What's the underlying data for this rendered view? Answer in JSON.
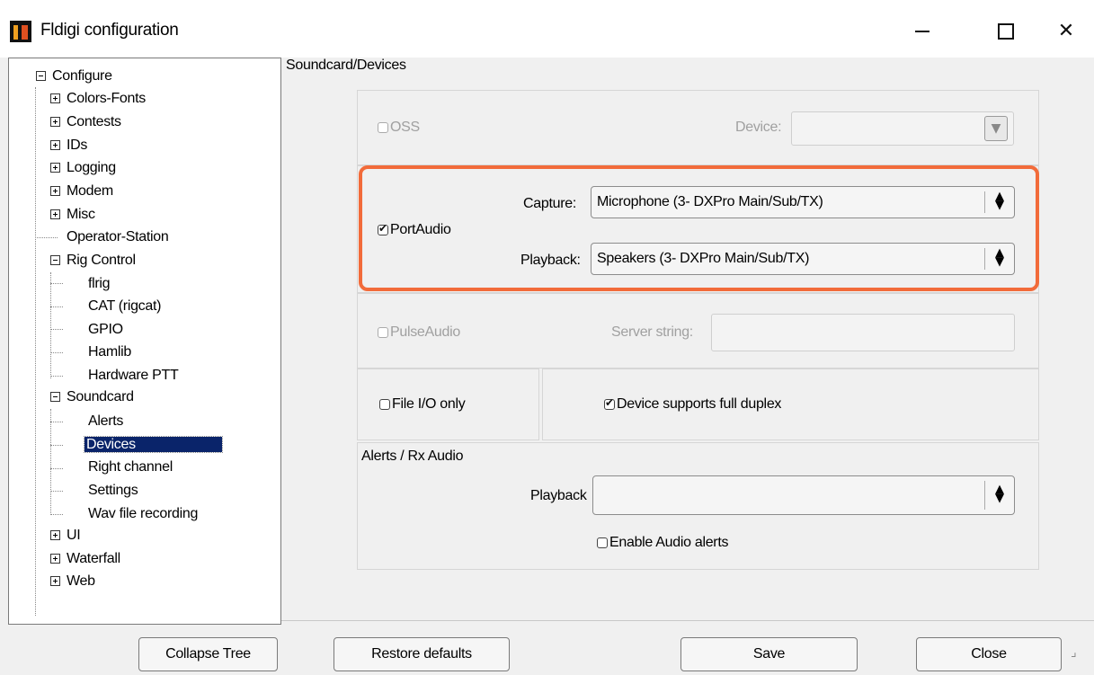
{
  "window": {
    "title": "Fldigi configuration"
  },
  "tree": {
    "items": [
      {
        "label": "Configure"
      },
      {
        "label": "Colors-Fonts"
      },
      {
        "label": "Contests"
      },
      {
        "label": "IDs"
      },
      {
        "label": "Logging"
      },
      {
        "label": "Modem"
      },
      {
        "label": "Misc"
      },
      {
        "label": "Operator-Station"
      },
      {
        "label": "Rig Control"
      },
      {
        "label": "flrig"
      },
      {
        "label": "CAT (rigcat)"
      },
      {
        "label": "GPIO"
      },
      {
        "label": "Hamlib"
      },
      {
        "label": "Hardware PTT"
      },
      {
        "label": "Soundcard"
      },
      {
        "label": "Alerts"
      },
      {
        "label": "Devices"
      },
      {
        "label": "Right channel"
      },
      {
        "label": "Settings"
      },
      {
        "label": "Wav file recording"
      },
      {
        "label": "UI"
      },
      {
        "label": "Waterfall"
      },
      {
        "label": "Web"
      }
    ],
    "selected": "Devices"
  },
  "section": {
    "title": "Soundcard/Devices"
  },
  "oss": {
    "label": "OSS",
    "device_label": "Device:",
    "device_value": ""
  },
  "portaudio": {
    "label": "PortAudio",
    "capture_label": "Capture:",
    "capture_value": "Microphone (3- DXPro Main/Sub/TX)",
    "playback_label": "Playback:",
    "playback_value": "Speakers (3- DXPro Main/Sub/TX)"
  },
  "pulseaudio": {
    "label": "PulseAudio",
    "server_label": "Server string:",
    "server_value": ""
  },
  "fileio": {
    "label": "File I/O only",
    "checked": false
  },
  "duplex": {
    "label": "Device supports full duplex",
    "checked": true
  },
  "alerts": {
    "title": "Alerts / Rx Audio",
    "playback_label": "Playback",
    "playback_value": "",
    "enable_label": "Enable Audio alerts"
  },
  "buttons": {
    "collapse": "Collapse Tree",
    "restore": "Restore defaults",
    "save": "Save",
    "close": "Close"
  },
  "colors": {
    "highlight": "#f26b3a",
    "selection": "#0a246a"
  }
}
